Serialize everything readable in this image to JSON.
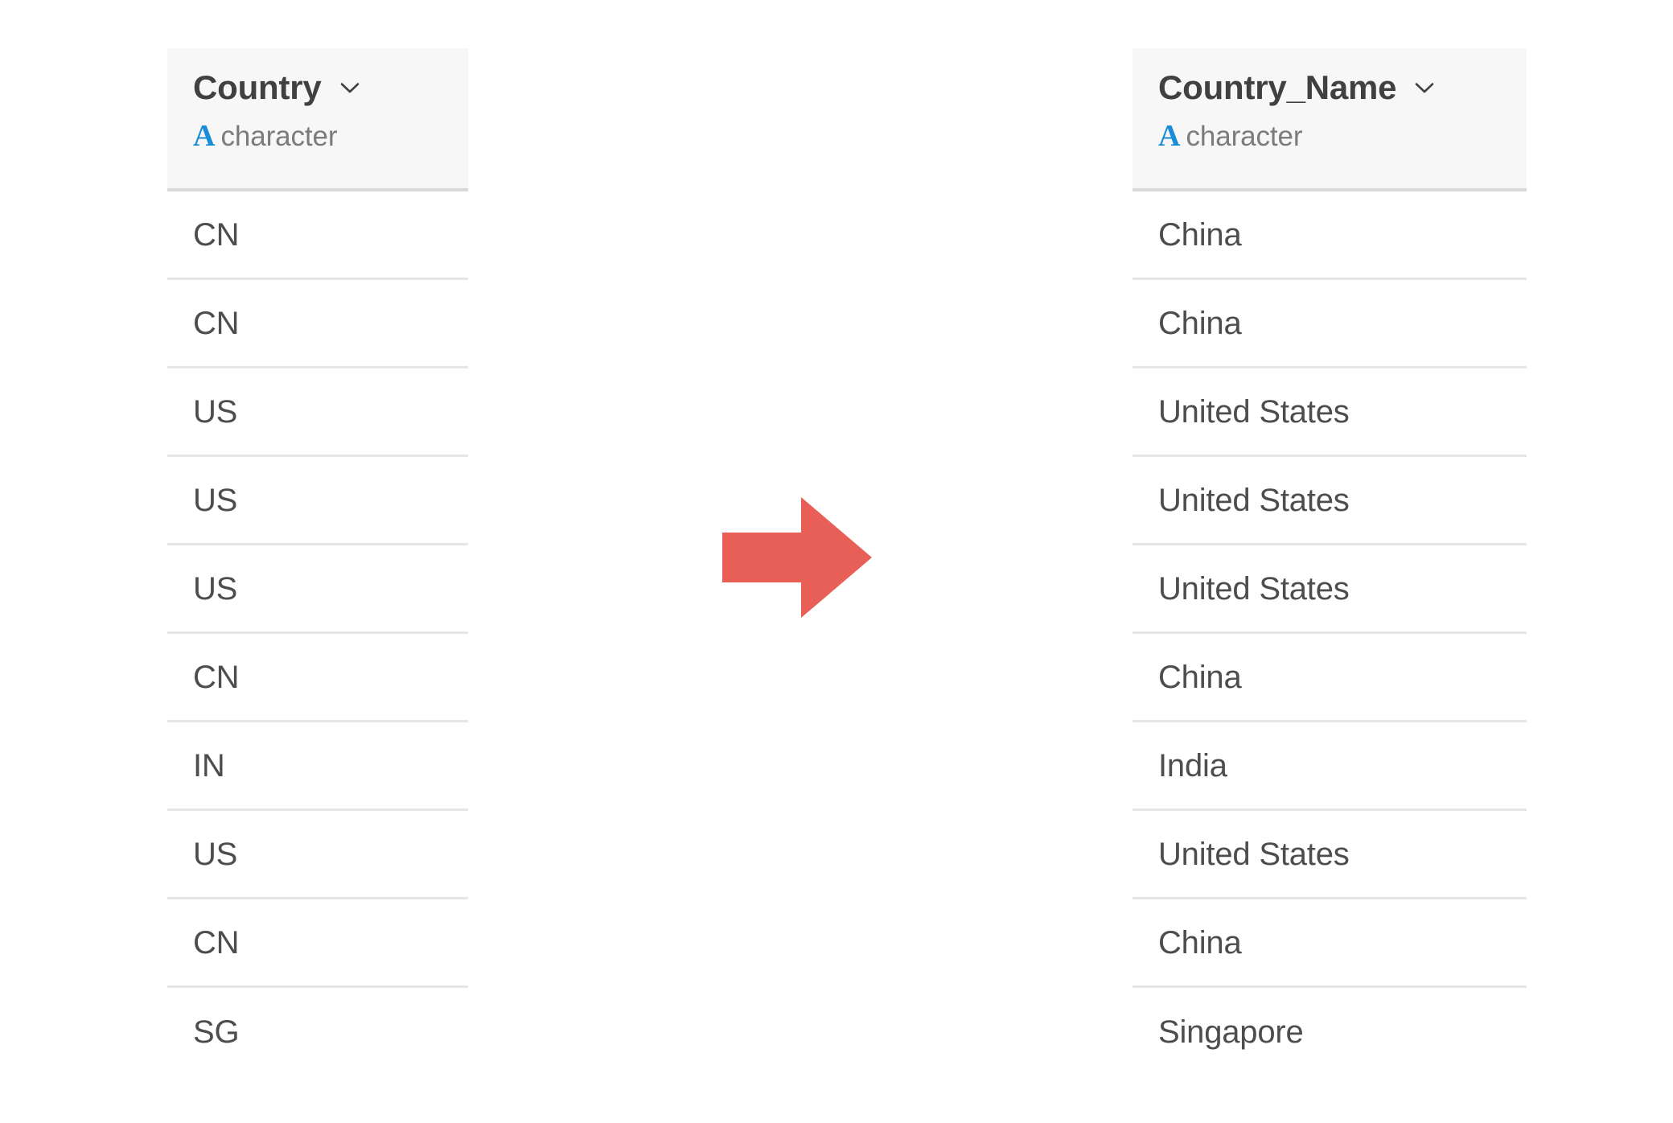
{
  "accent": {
    "arrow_color": "#e85f58",
    "type_glyph_color": "#1a8cd8",
    "header_bg": "#f7f7f7",
    "row_border": "#e6e6e6",
    "header_border": "#d9d9d9",
    "text_color": "#4d4d4d",
    "title_color": "#404040"
  },
  "source_column": {
    "title": "Country",
    "type_glyph": "A",
    "type_label": "character",
    "dropdown_icon": "chevron-down-icon",
    "values": [
      "CN",
      "CN",
      "US",
      "US",
      "US",
      "CN",
      "IN",
      "US",
      "CN",
      "SG"
    ]
  },
  "target_column": {
    "title": "Country_Name",
    "type_glyph": "A",
    "type_label": "character",
    "dropdown_icon": "chevron-down-icon",
    "values": [
      "China",
      "China",
      "United States",
      "United States",
      "United States",
      "China",
      "India",
      "United States",
      "China",
      "Singapore"
    ]
  },
  "transform": {
    "icon": "arrow-right-icon"
  }
}
